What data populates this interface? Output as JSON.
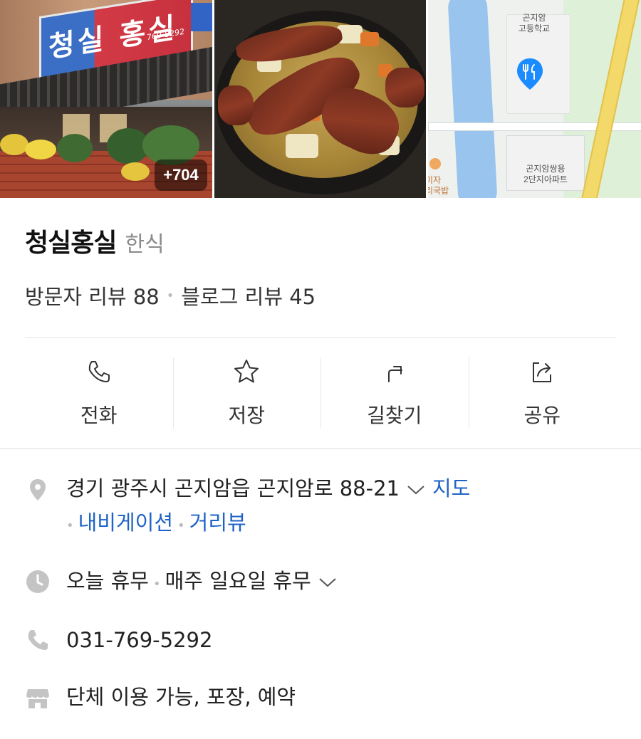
{
  "photos": {
    "count_badge": "+704",
    "sign_text": "청실 홍실",
    "sign_phone": "769-5292",
    "map_labels": {
      "school": "곤지암\n고등학교",
      "apartment": "곤지암쌍용\n2단지아파트",
      "restaurant": "미자\n리국밥"
    }
  },
  "place": {
    "name": "청실홍실",
    "category": "한식",
    "visitor_review": "방문자 리뷰 88",
    "blog_review": "블로그 리뷰 45"
  },
  "actions": [
    {
      "label": "전화",
      "icon": "phone-icon"
    },
    {
      "label": "저장",
      "icon": "star-icon"
    },
    {
      "label": "길찾기",
      "icon": "directions-icon"
    },
    {
      "label": "공유",
      "icon": "share-icon"
    }
  ],
  "info": {
    "address": "경기 광주시 곤지암읍 곤지암로 88-21",
    "map_link": "지도",
    "navigation_link": "내비게이션",
    "streetview_link": "거리뷰",
    "hours_status": "오늘 휴무",
    "hours_detail": "매주 일요일 휴무",
    "phone": "031-769-5292",
    "amenities": "단체 이용 가능, 포장, 예약"
  },
  "colors": {
    "link": "#1f63c6",
    "icon_gray": "#c4c4c4",
    "map_pin": "#1a8cff"
  }
}
